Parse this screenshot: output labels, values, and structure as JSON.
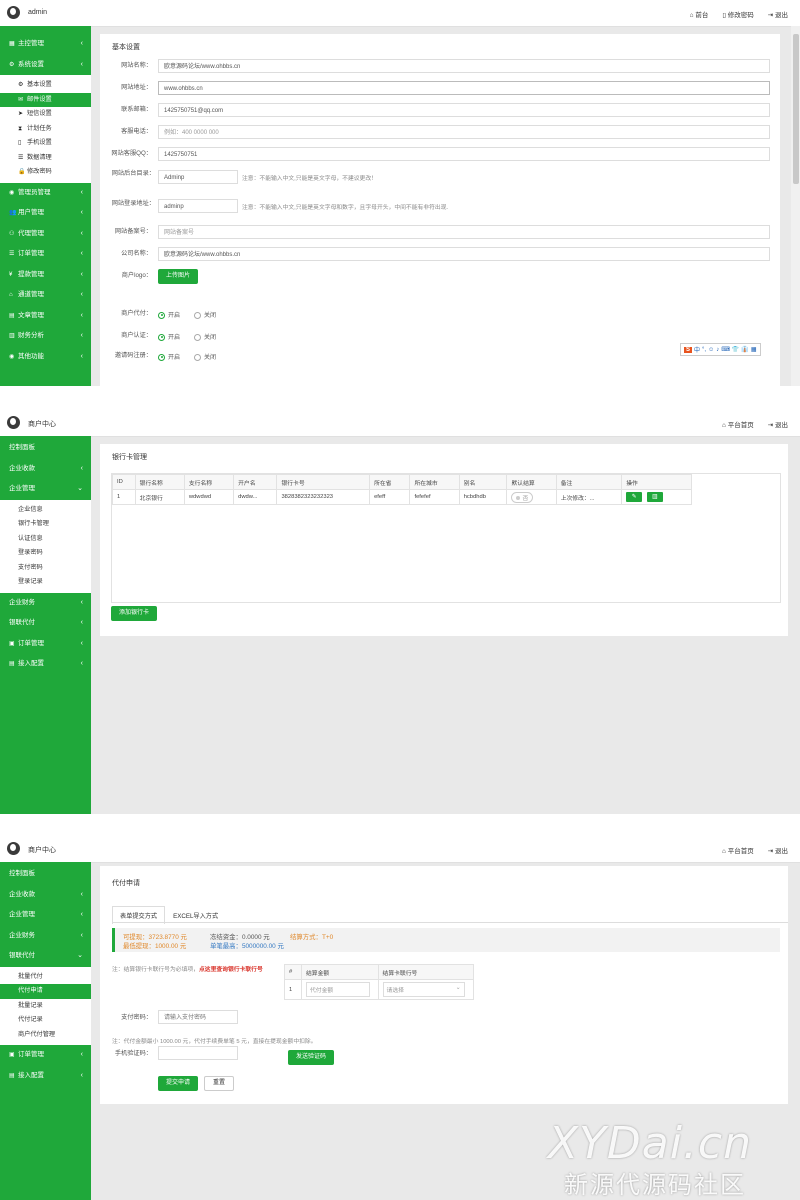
{
  "screen1": {
    "brand": "admin",
    "toplinks": [
      "前台",
      "修改密码",
      "退出"
    ],
    "nav": [
      {
        "label": "主控管理"
      },
      {
        "label": "系统设置"
      },
      {
        "label": "管理员管理"
      },
      {
        "label": "用户管理"
      },
      {
        "label": "代理管理"
      },
      {
        "label": "订单管理"
      },
      {
        "label": "提款管理"
      },
      {
        "label": "通道管理"
      },
      {
        "label": "文章管理"
      },
      {
        "label": "财务分析"
      },
      {
        "label": "其他功能"
      }
    ],
    "submenu": [
      "基本设置",
      "邮件设置",
      "短信设置",
      "计划任务",
      "手机设置",
      "数据清理",
      "修改密码"
    ],
    "panel_title": "基本设置",
    "fields": [
      {
        "label": "网站名称：",
        "value": "欧意源码论坛/www.ohbbs.cn"
      },
      {
        "label": "网站地址：",
        "value": "www.ohbbs.cn"
      },
      {
        "label": "联系邮箱：",
        "value": "1425750751@qq.com"
      },
      {
        "label": "客服电话：",
        "value": "例如：400 0000 000"
      },
      {
        "label": "网站客服QQ：",
        "value": "1425750751"
      }
    ],
    "admin_dir": {
      "label": "网站后台目录：",
      "value": "Adminp",
      "note": "注意：不能输入中文,只能是英文字母，不建议更改！"
    },
    "login_addr": {
      "label": "网站登录地址：",
      "value": "adminp",
      "note": "注意：不能输入中文,只能是英文字母和数字，且字母开头，中间不能有非符出现."
    },
    "icp": {
      "label": "网站备案号：",
      "value": "网站备案号"
    },
    "company": {
      "label": "公司名称：",
      "value": "欧意源码论坛/www.ohbbs.cn"
    },
    "logo": {
      "label": "商户logo：",
      "button": "上传图片"
    },
    "radios": [
      {
        "label": "商户代付：",
        "on": "开启",
        "off": "关闭"
      },
      {
        "label": "商户认证：",
        "on": "开启",
        "off": "关闭"
      },
      {
        "label": "邀请码注册：",
        "on": "开启",
        "off": "关闭"
      }
    ],
    "ime": [
      "S",
      "中",
      "°,",
      "☺",
      "♪",
      "⌨",
      "👕",
      "👔",
      "▦"
    ]
  },
  "screen2": {
    "brand": "商户中心",
    "toplinks": [
      "平台首页",
      "退出"
    ],
    "nav_top": [
      "控制面板",
      "企业收款",
      "企业管理"
    ],
    "submenu": [
      "企业信息",
      "银行卡管理",
      "认证信息",
      "登录密码",
      "支付密码",
      "登录记录"
    ],
    "nav_bottom": [
      "企业财务",
      "银联代付",
      "订单管理",
      "接入配置"
    ],
    "panel_title": "银行卡管理",
    "table": {
      "headers": [
        "ID",
        "银行名称",
        "支行名称",
        "开户名",
        "银行卡号",
        "所在省",
        "所在城市",
        "别名",
        "默认结算",
        "备注",
        "操作"
      ],
      "rows": [
        [
          "1",
          "北京银行",
          "wdwdwd",
          "dwdw...",
          "3828382323232323",
          "efeff",
          "fefefef",
          "hcbdhdb",
          "否",
          "上次修改：...",
          ""
        ]
      ]
    },
    "add_button": "添加银行卡"
  },
  "screen3": {
    "brand": "商户中心",
    "toplinks": [
      "平台首页",
      "退出"
    ],
    "nav_top": [
      "控制面板",
      "企业收款",
      "企业管理",
      "企业财务",
      "银联代付"
    ],
    "submenu": [
      "批量代付",
      "代付申请",
      "批量记录",
      "代付记录",
      "商户代付管理"
    ],
    "nav_bottom": [
      "订单管理",
      "接入配置"
    ],
    "panel_title": "代付申请",
    "tabs": [
      "表单提交方式",
      "EXCEL导入方式"
    ],
    "info": {
      "available": "可提现：3723.8770 元",
      "frozen": "冻结资金：0.0000 元",
      "settle": "结算方式：T+0",
      "min": "最低提现：1000.00 元",
      "max": "单笔最高：5000000.00 元"
    },
    "note1_prefix": "注：结算银行卡联行号为必填项，",
    "note1_link": "点这里查询银行卡联行号",
    "mini_table": {
      "headers": [
        "#",
        "结算金额",
        "结算卡联行号"
      ],
      "row_num": "1",
      "amount_placeholder": "代付金额",
      "select_placeholder": "请选择"
    },
    "pay_pwd": {
      "label": "支付密码：",
      "placeholder": "请输入支付密码"
    },
    "note2": "注：代付金额最小 1000.00 元，代付手续费单笔 5 元，直接在提现金额中扣除。",
    "sms": {
      "label": "手机验证码：",
      "button": "发送验证码"
    },
    "submit": "提交申请",
    "reset": "重置"
  },
  "watermark": {
    "line1": "XYDai.cn",
    "line2": "新源代源码社区"
  }
}
